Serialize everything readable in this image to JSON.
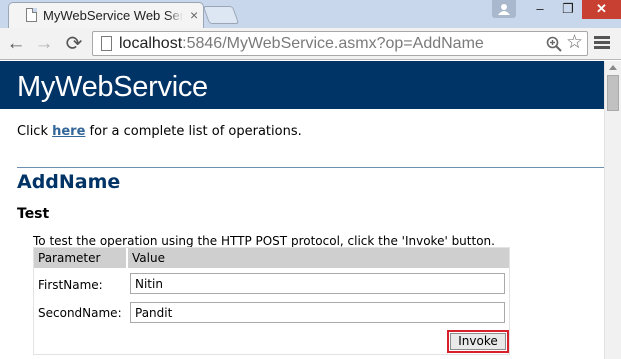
{
  "browser": {
    "tab_title": "MyWebService Web Service",
    "tab_close": "×",
    "url_host": "localhost",
    "url_rest": ":5846/MyWebService.asmx?op=AddName",
    "window_controls": {
      "minimize": "–",
      "maximize": "❐",
      "close": "✕"
    },
    "nav": {
      "back": "←",
      "forward": "→",
      "reload": "⟳"
    },
    "star": "☆"
  },
  "page": {
    "banner_title": "MyWebService",
    "intro": {
      "prefix": "Click ",
      "link": "here",
      "suffix": " for a complete list of operations."
    },
    "operation_title": "AddName",
    "test_heading": "Test",
    "instruction": "To test the operation using the HTTP POST protocol, click the 'Invoke' button.",
    "table": {
      "headers": [
        "Parameter",
        "Value"
      ],
      "rows": [
        {
          "label": "FirstName:",
          "value": "Nitin"
        },
        {
          "label": "SecondName:",
          "value": "Pandit"
        }
      ]
    },
    "invoke_label": "Invoke"
  },
  "colors": {
    "banner": "#003366",
    "link": "#336699",
    "table_header": "#cecfce",
    "invoke_highlight": "#d6202c",
    "window_close": "#c84031"
  },
  "icons": [
    "page-icon",
    "profile-icon",
    "back-arrow-icon",
    "forward-arrow-icon",
    "reload-icon",
    "zoom-icon",
    "star-icon",
    "menu-icon"
  ]
}
